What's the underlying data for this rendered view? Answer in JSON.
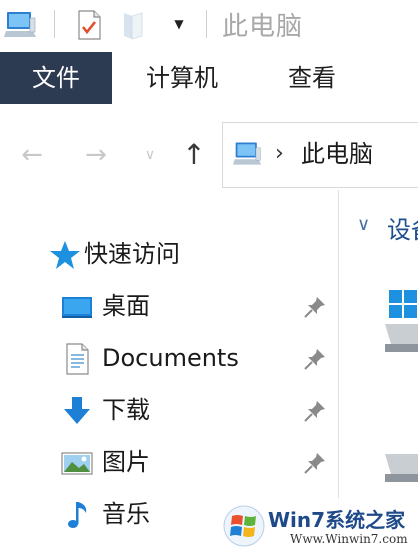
{
  "window": {
    "title": "此电脑",
    "quick_access_toolbar": [
      "computer-icon",
      "properties-icon",
      "new-folder-icon",
      "customize-dropdown-icon"
    ]
  },
  "ribbon": {
    "tabs": [
      {
        "label": "文件",
        "active": true
      },
      {
        "label": "计算机",
        "active": false
      },
      {
        "label": "查看",
        "active": false
      }
    ]
  },
  "navigation": {
    "address": {
      "location": "此电脑"
    }
  },
  "nav_pane": {
    "quick_access": {
      "label": "快速访问"
    },
    "items": [
      {
        "label": "桌面",
        "icon": "desktop-icon",
        "pinned": true
      },
      {
        "label": "Documents",
        "icon": "documents-icon",
        "pinned": true
      },
      {
        "label": "下载",
        "icon": "downloads-icon",
        "pinned": true
      },
      {
        "label": "图片",
        "icon": "pictures-icon",
        "pinned": true
      },
      {
        "label": "音乐",
        "icon": "music-icon",
        "pinned": false
      }
    ]
  },
  "content": {
    "group_title": "设备和驱动器"
  },
  "watermark": {
    "brand": "Win7系统之家",
    "url": "Www.Winwin7.com"
  },
  "colors": {
    "ribbon_file_tab": "#2d3b52",
    "accent_blue": "#1f4e8c",
    "icon_blue": "#1e90e0"
  }
}
